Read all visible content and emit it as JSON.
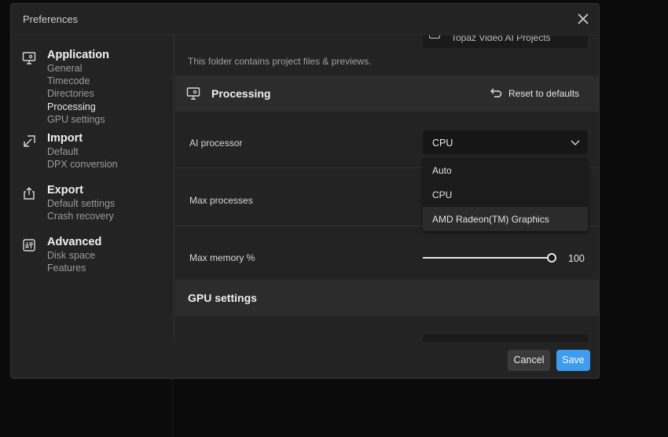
{
  "window": {
    "title": "Preferences"
  },
  "sidebar": {
    "groups": [
      {
        "label": "Application",
        "icon": "monitor-settings-icon",
        "items": [
          "General",
          "Timecode",
          "Directories",
          "Processing",
          "GPU settings"
        ]
      },
      {
        "label": "Import",
        "icon": "import-icon",
        "items": [
          "Default",
          "DPX conversion"
        ]
      },
      {
        "label": "Export",
        "icon": "export-icon",
        "items": [
          "Default settings",
          "Crash recovery"
        ]
      },
      {
        "label": "Advanced",
        "icon": "sliders-icon",
        "items": [
          "Disk space",
          "Features"
        ]
      }
    ],
    "active_item": "Processing"
  },
  "content": {
    "folder_text_partial": "Topaz Video AI Projects",
    "folder_hint": "This folder contains project files & previews.",
    "processing": {
      "title": "Processing",
      "reset_label": "Reset to defaults",
      "ai_processor": {
        "label": "AI processor",
        "value": "CPU",
        "options": [
          "Auto",
          "CPU",
          "AMD Radeon(TM) Graphics"
        ],
        "hovered_option": "AMD Radeon(TM) Graphics"
      },
      "max_processes": {
        "label": "Max processes"
      },
      "max_memory": {
        "label": "Max memory %",
        "value": "100",
        "percent": 100
      }
    },
    "gpu_settings": {
      "title": "GPU settings"
    }
  },
  "footer": {
    "cancel_label": "Cancel",
    "save_label": "Save"
  },
  "colors": {
    "accent": "#3d9bf0",
    "dialog_bg": "#232323",
    "section_bg": "#2c2c2c",
    "input_bg": "#161616"
  }
}
